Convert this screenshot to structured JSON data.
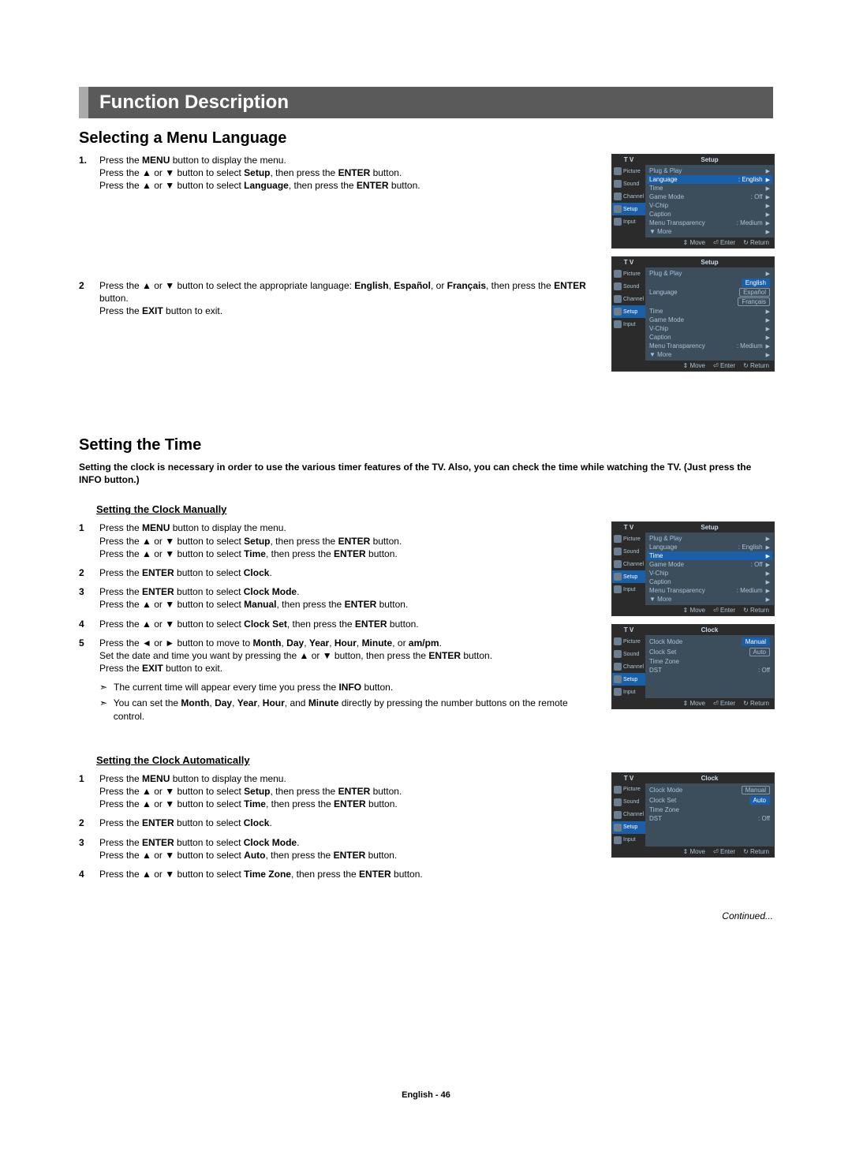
{
  "titleBar": "Function Description",
  "section1": {
    "heading": "Selecting a Menu Language",
    "steps": [
      {
        "num": "1.",
        "html": "Press the <b>MENU</b> button to display the menu.<br>Press the ▲ or ▼ button to select <b>Setup</b>, then press the <b>ENTER</b> button.<br>Press the ▲ or ▼ button to select <b>Language</b>, then press the <b>ENTER</b> button."
      },
      {
        "num": "2",
        "html": "Press the ▲ or ▼ button to select the appropriate language: <b>English</b>, <b>Español</b>, or <b>Français</b>, then press the <b>ENTER</b> button.<br>Press the <b>EXIT</b> button to exit."
      }
    ]
  },
  "section2": {
    "heading": "Setting the Time",
    "intro": "Setting the clock is necessary in order to use the various timer features of the TV. Also, you can check the time while watching the TV. (Just press the INFO button.)",
    "sub1": "Setting the Clock Manually",
    "steps1": [
      {
        "num": "1",
        "html": "Press the <b>MENU</b> button to display the menu.<br>Press the ▲ or ▼ button to select <b>Setup</b>, then press the <b>ENTER</b> button.<br>Press the ▲ or ▼ button to select <b>Time</b>, then press the <b>ENTER</b> button."
      },
      {
        "num": "2",
        "html": "Press the <b>ENTER</b> button to select <b>Clock</b>."
      },
      {
        "num": "3",
        "html": "Press the <b>ENTER</b> button to select <b>Clock Mode</b>.<br>Press the ▲ or ▼ button to select <b>Manual</b>, then press the <b>ENTER</b> button."
      },
      {
        "num": "4",
        "html": "Press the ▲ or ▼ button to select <b>Clock Set</b>, then press the <b>ENTER</b> button."
      },
      {
        "num": "5",
        "html": "Press the ◄ or ► button to  move to <b>Month</b>, <b>Day</b>, <b>Year</b>, <b>Hour</b>, <b>Minute</b>, or <b>am/pm</b>.<br>Set the date and time you want by pressing the ▲ or ▼ button, then press the <b>ENTER</b> button.<br>Press the <b>EXIT</b> button to exit."
      }
    ],
    "notes1": [
      "The current time will appear every time you press the <b>INFO</b> button.",
      "You can set the <b>Month</b>, <b>Day</b>, <b>Year</b>, <b>Hour</b>, and <b>Minute</b> directly by pressing the number buttons on the remote control."
    ],
    "sub2": "Setting the Clock Automatically",
    "steps2": [
      {
        "num": "1",
        "html": "Press the <b>MENU</b> button to display the menu.<br>Press the ▲ or ▼ button to select <b>Setup</b>, then press the <b>ENTER</b> button.<br>Press the ▲ or ▼ button to select <b>Time</b>, then press the <b>ENTER</b> button."
      },
      {
        "num": "2",
        "html": "Press the <b>ENTER</b> button to select <b>Clock</b>."
      },
      {
        "num": "3",
        "html": "Press the <b>ENTER</b> button to select <b>Clock Mode</b>.<br>Press the ▲ or ▼ button to select <b>Auto</b>, then press the <b>ENTER</b> button."
      },
      {
        "num": "4",
        "html": "Press the ▲ or ▼ button to select <b>Time Zone</b>, then press the <b>ENTER</b> button."
      }
    ]
  },
  "osd": {
    "tvLabel": "T V",
    "sideItems": [
      "Picture",
      "Sound",
      "Channel",
      "Setup",
      "Input"
    ],
    "foot": {
      "move": "Move",
      "enter": "Enter",
      "return": "Return"
    },
    "setup1": {
      "title": "Setup",
      "rows": [
        {
          "label": "Plug & Play",
          "val": "",
          "sel": false
        },
        {
          "label": "Language",
          "val": ": English",
          "sel": true
        },
        {
          "label": "Time",
          "val": "",
          "sel": false
        },
        {
          "label": "Game Mode",
          "val": ": Off",
          "sel": false
        },
        {
          "label": "V-Chip",
          "val": "",
          "sel": false
        },
        {
          "label": "Caption",
          "val": "",
          "sel": false
        },
        {
          "label": "Menu Transparency",
          "val": ": Medium",
          "sel": false
        },
        {
          "label": "▼ More",
          "val": "",
          "sel": false
        }
      ]
    },
    "setup2": {
      "title": "Setup",
      "rows": [
        {
          "label": "Plug & Play",
          "val": ""
        },
        {
          "label": "Language",
          "val": ""
        },
        {
          "label": "Time",
          "val": ""
        },
        {
          "label": "Game Mode",
          "val": ""
        },
        {
          "label": "V-Chip",
          "val": ""
        },
        {
          "label": "Caption",
          "val": ""
        },
        {
          "label": "Menu Transparency",
          "val": ": Medium"
        },
        {
          "label": "▼ More",
          "val": ""
        }
      ],
      "options": [
        "English",
        "Español",
        "Français"
      ],
      "optSel": 0
    },
    "setup3": {
      "title": "Setup",
      "rows": [
        {
          "label": "Plug & Play",
          "val": "",
          "sel": false
        },
        {
          "label": "Language",
          "val": ": English",
          "sel": false
        },
        {
          "label": "Time",
          "val": "",
          "sel": true
        },
        {
          "label": "Game Mode",
          "val": ": Off",
          "sel": false
        },
        {
          "label": "V-Chip",
          "val": "",
          "sel": false
        },
        {
          "label": "Caption",
          "val": "",
          "sel": false
        },
        {
          "label": "Menu Transparency",
          "val": ": Medium",
          "sel": false
        },
        {
          "label": "▼ More",
          "val": "",
          "sel": false
        }
      ]
    },
    "clock1": {
      "title": "Clock",
      "rows": [
        {
          "label": "Clock Mode",
          "opt": "Manual",
          "optSel": true
        },
        {
          "label": "Clock Set",
          "opt": "Auto",
          "optSel": false
        },
        {
          "label": "Time Zone",
          "val": ""
        },
        {
          "label": "DST",
          "val": ": Off"
        }
      ]
    },
    "clock2": {
      "title": "Clock",
      "rows": [
        {
          "label": "Clock Mode",
          "opt": "Manual",
          "optSel": false
        },
        {
          "label": "Clock Set",
          "opt": "Auto",
          "optSel": true
        },
        {
          "label": "Time Zone",
          "val": ""
        },
        {
          "label": "DST",
          "val": ": Off"
        }
      ]
    }
  },
  "continued": "Continued...",
  "pageFoot": "English - 46"
}
